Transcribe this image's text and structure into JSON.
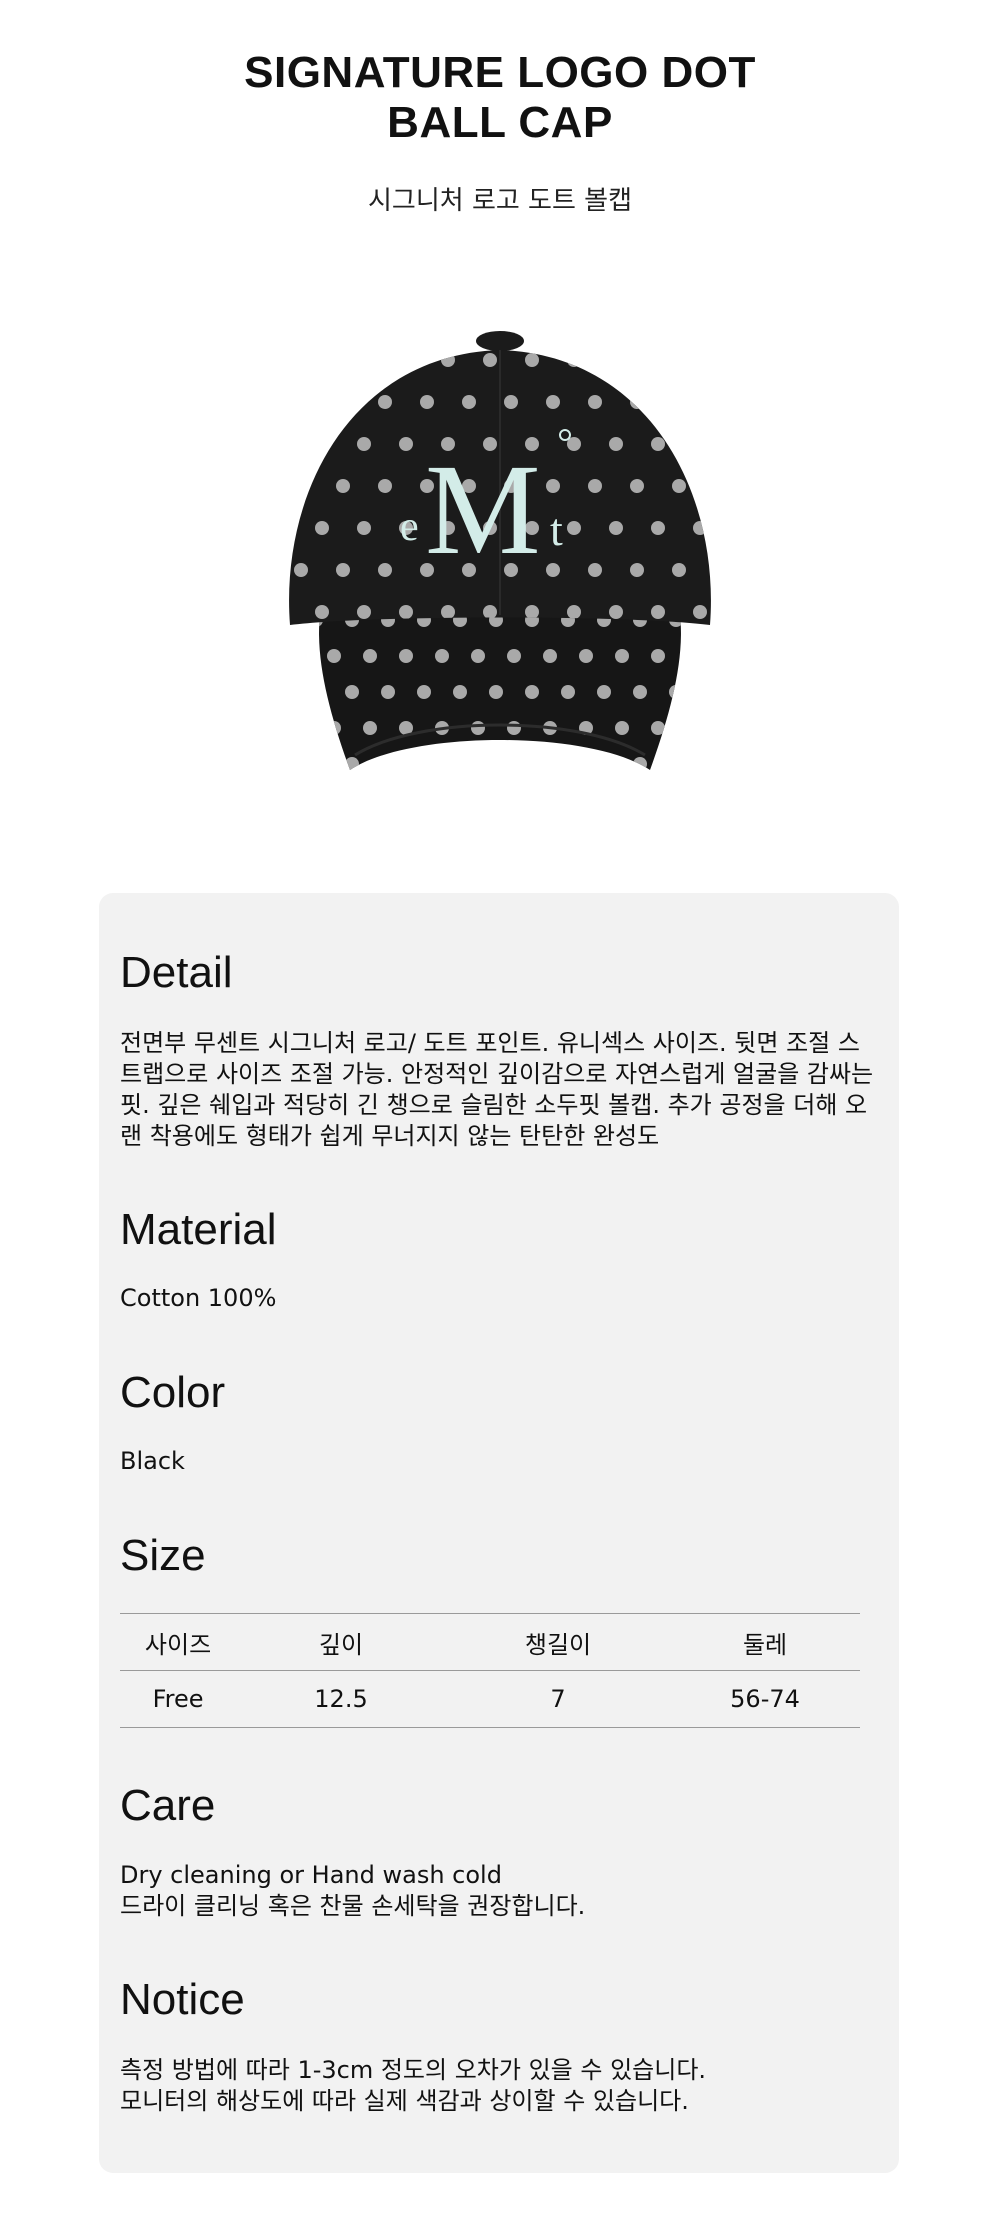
{
  "product": {
    "title_lines": [
      "SIGNATURE LOGO DOT",
      "BALL CAP"
    ],
    "subtitle": "시그니처 로고 도트 볼캡",
    "logo_text": "eMt",
    "hero_image": "black-polka-dot-baseball-cap"
  },
  "detail": {
    "heading": "Detail",
    "lines": [
      "전면부 무센트 시그니처 로고/ 도트 포인트. 유니섹스 사이즈. 뒷면 조절 스",
      "트랩으로 사이즈 조절 가능. 안정적인 깊이감으로 자연스럽게 얼굴을 감싸는",
      "핏. 깊은 쉐입과 적당히 긴 챙으로 슬림한 소두핏 볼캡. 추가 공정을 더해 오",
      "랜 착용에도 형태가 쉽게 무너지지 않는 탄탄한 완성도"
    ]
  },
  "material": {
    "heading": "Material",
    "text": "Cotton 100%"
  },
  "color": {
    "heading": "Color",
    "text": "Black"
  },
  "size": {
    "heading": "Size",
    "columns": [
      "사이즈",
      "깊이",
      "챙길이",
      "둘레"
    ],
    "rows": [
      [
        "Free",
        "12.5",
        "7",
        "56-74"
      ]
    ]
  },
  "care": {
    "heading": "Care",
    "lines": [
      "Dry cleaning or Hand wash cold",
      "드라이 클리닝 혹은 찬물 손세탁을 권장합니다."
    ]
  },
  "notice": {
    "heading": "Notice",
    "lines": [
      "측정 방법에 따라 1-3cm 정도의 오차가 있을 수 있습니다.",
      "모니터의 해상도에 따라 실제 색감과 상이할 수 있습니다."
    ]
  },
  "colors": {
    "panel_bg": "#f2f2f2",
    "cap": "#1b1b1b",
    "dot": "#a9a9a9",
    "logo": "#d3ece8"
  }
}
